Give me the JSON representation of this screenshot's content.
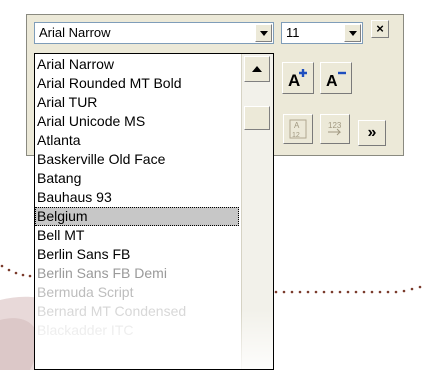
{
  "toolbar": {
    "font_name_value": "Arial Narrow",
    "font_size_value": "11",
    "close_label": "×",
    "grow_font_label": "A",
    "shrink_font_label": "A",
    "more_label": "»"
  },
  "font_list": {
    "items": [
      {
        "label": "Arial Narrow",
        "style": ""
      },
      {
        "label": "Arial Rounded MT Bold",
        "style": ""
      },
      {
        "label": "Arial TUR",
        "style": ""
      },
      {
        "label": "Arial Unicode MS",
        "style": ""
      },
      {
        "label": "Atlanta",
        "style": ""
      },
      {
        "label": "Baskerville Old Face",
        "style": ""
      },
      {
        "label": "Batang",
        "style": ""
      },
      {
        "label": "Bauhaus 93",
        "style": ""
      },
      {
        "label": "Belgium",
        "style": "selected"
      },
      {
        "label": "Bell MT",
        "style": ""
      },
      {
        "label": "Berlin Sans FB",
        "style": ""
      },
      {
        "label": "Berlin Sans FB Demi",
        "style": "faded1"
      },
      {
        "label": "Bermuda Script",
        "style": "faded2"
      },
      {
        "label": "Bernard MT Condensed",
        "style": "faded3"
      },
      {
        "label": "Blackadder ITC",
        "style": "faded4"
      }
    ]
  },
  "colors": {
    "toolbar_bg": "#ece9d8",
    "selection_bg": "#c7c7c7",
    "grow_plus": "#1f4fbf",
    "shrink_minus": "#1f4fbf",
    "dots": "#7a3b2c",
    "swoosh": "#e9dada"
  },
  "icons": [
    "chevron-down-icon",
    "close-icon",
    "grow-font-icon",
    "shrink-font-icon",
    "character-scale-icon",
    "text-direction-icon",
    "more-options-icon",
    "scroll-up-icon"
  ]
}
